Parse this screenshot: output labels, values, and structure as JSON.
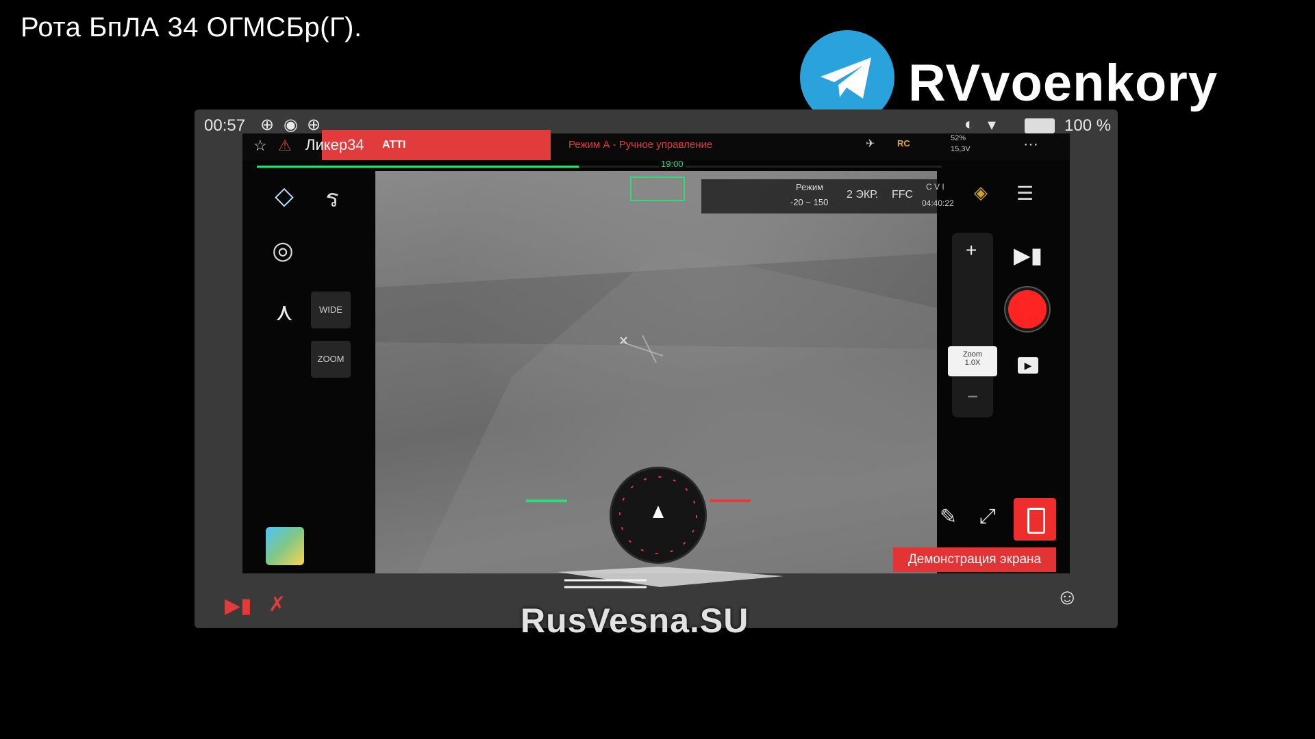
{
  "caption": "Рота БпЛА 34 ОГМСБр(Г).",
  "telegram": {
    "brand": "RVvoenkory",
    "icon": "telegram-icon",
    "color": "#2aa3dd"
  },
  "status_bar": {
    "time": "00:57",
    "battery": "100 %"
  },
  "app": {
    "drone_name": "Ликер34",
    "flight_mode": "ATTI",
    "mode_text": "Режим А - Ручное управление",
    "battery_pct": "52%",
    "voltage": "15,3V",
    "progress_time": "19:00",
    "progress_fraction": 0.47,
    "cam_settings": {
      "mode_label": "Режим",
      "range": "-20 ~ 150",
      "palette": "2 ЭКР.",
      "ffc": "FFC",
      "storage": "C V I",
      "rec_time": "04:40:22"
    },
    "left_buttons": {
      "wide": "WIDE",
      "zoom": "ZOOM"
    },
    "zoom_label": "Zoom",
    "zoom_value": "1.0X",
    "screen_share": "Демонстрация экрана",
    "watermark": "RusVesna.SU",
    "accent_red": "#e23b3b",
    "accent_green": "#2fdc7a"
  }
}
